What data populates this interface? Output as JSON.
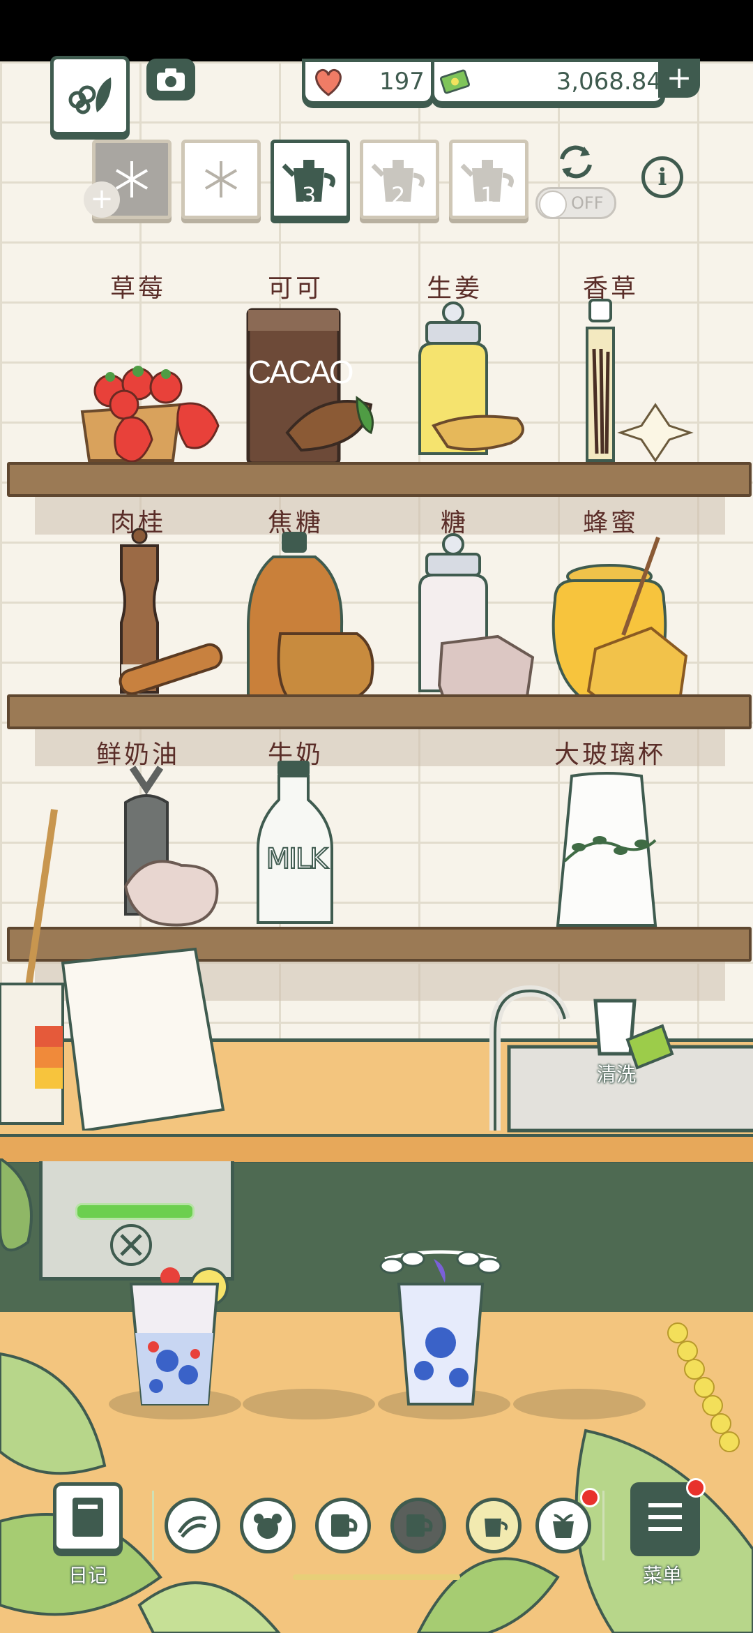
{
  "hud": {
    "hearts": "197",
    "money": "3,068.84",
    "money_plus": "+",
    "toggle_state": "OFF",
    "info_symbol": "i",
    "add_symbol": "+"
  },
  "slots": [
    {
      "number": ""
    },
    {
      "number": ""
    },
    {
      "number": "3"
    },
    {
      "number": "2"
    },
    {
      "number": "1"
    }
  ],
  "shelves": {
    "row1": [
      "草莓",
      "可可",
      "生姜",
      "香草"
    ],
    "row2": [
      "肉桂",
      "焦糖",
      "糖",
      "蜂蜜"
    ],
    "row3": [
      "鲜奶油",
      "牛奶",
      "大玻璃杯"
    ]
  },
  "jar_text": {
    "cacao": "CACAO",
    "milk": "MILK"
  },
  "sink": {
    "wash_label": "清洗"
  },
  "bottom": {
    "diary_label": "日记",
    "menu_label": "菜单"
  },
  "colors": {
    "ui_dark_green": "#3f5b4f",
    "shelf_wood": "#9b7a55",
    "counter": "#f3c57e",
    "label_red_brown": "#5a2d28",
    "notification_red": "#e8312c",
    "progress_green": "#6ccf4f"
  },
  "icons": {
    "hearts": "heart-icon",
    "money": "cash-icon",
    "camera": "camera-icon",
    "album": "leaf-logo-icon",
    "refresh": "swap-arrows-icon"
  }
}
